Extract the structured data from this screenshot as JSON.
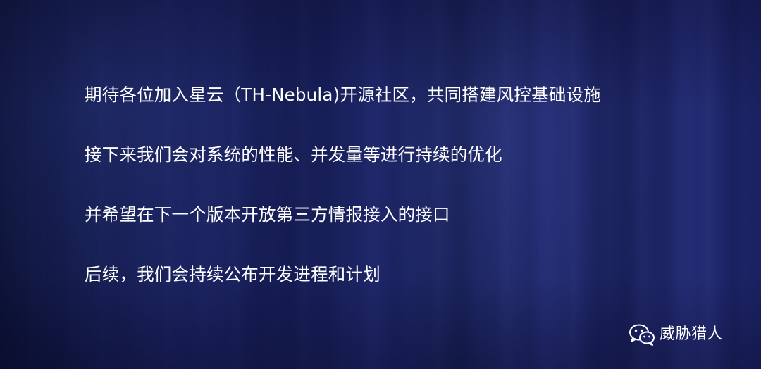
{
  "slide": {
    "lines": [
      "期待各位加入星云（TH-Nebula)开源社区，共同搭建风控基础设施",
      "接下来我们会对系统的性能、并发量等进行持续的优化",
      "并希望在下一个版本开放第三方情报接入的接口",
      "后续，我们会持续公布开发进程和计划"
    ]
  },
  "brand": {
    "icon": "wechat-icon",
    "label": "威胁猎人"
  },
  "colors": {
    "background_dark": "#0b1133",
    "background_mid": "#1e2668",
    "text": "#ffffff"
  }
}
